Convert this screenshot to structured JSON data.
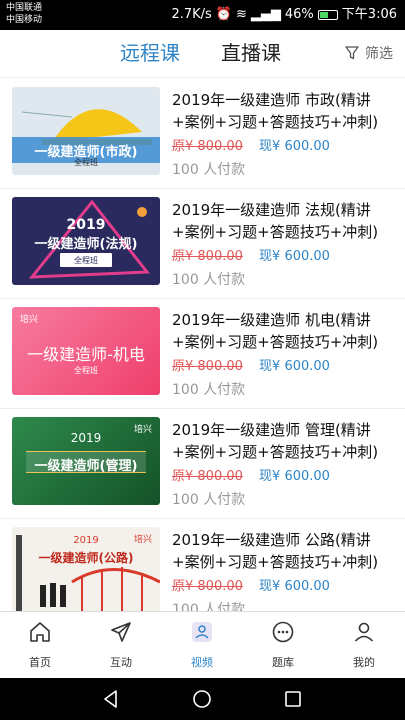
{
  "status_bar": {
    "carrier_1": "中国联通",
    "carrier_2": "中国移动",
    "speed": "2.7K/s",
    "battery": "46%",
    "time": "下午3:06"
  },
  "header": {
    "tab_remote": "远程课",
    "tab_live": "直播课",
    "filter_label": "筛选"
  },
  "courses": [
    {
      "title": "2019年一级建造师 市政(精讲+案例+习题+答题技巧+冲刺)",
      "original_price": "原¥ 800.00",
      "current_price": "现¥ 600.00",
      "buyers": "100 人付款",
      "thumb_caption": "一级建造师(市政)",
      "thumb_sub": "全程班",
      "thumb_color": "#f5c518"
    },
    {
      "title": "2019年一级建造师 法规(精讲+案例+习题+答题技巧+冲刺)",
      "original_price": "原¥ 800.00",
      "current_price": "现¥ 600.00",
      "buyers": "100 人付款",
      "thumb_year": "2019",
      "thumb_caption": "一级建造师(法规)",
      "thumb_sub": "全程班",
      "thumb_color": "#2a2a5e"
    },
    {
      "title": "2019年一级建造师 机电(精讲+案例+习题+答题技巧+冲刺)",
      "original_price": "原¥ 800.00",
      "current_price": "现¥ 600.00",
      "buyers": "100 人付款",
      "thumb_logo": "培兴",
      "thumb_caption": "一级建造师-机电",
      "thumb_sub": "全程班",
      "thumb_color": "#f2507a"
    },
    {
      "title": "2019年一级建造师 管理(精讲+案例+习题+答题技巧+冲刺)",
      "original_price": "原¥ 800.00",
      "current_price": "现¥ 600.00",
      "buyers": "100 人付款",
      "thumb_year": "2019",
      "thumb_caption": "一级建造师(管理)",
      "thumb_logo": "培兴",
      "thumb_color": "#1f6b3a"
    },
    {
      "title": "2019年一级建造师 公路(精讲+案例+习题+答题技巧+冲刺)",
      "original_price": "原¥ 800.00",
      "current_price": "现¥ 600.00",
      "buyers": "100 人付款",
      "thumb_year": "2019",
      "thumb_caption": "一级建造师(公路)",
      "thumb_logo": "培兴",
      "thumb_color": "#d93a2b"
    }
  ],
  "bottom_nav": {
    "home": "首页",
    "interact": "互动",
    "video": "视频",
    "question_bank": "题库",
    "mine": "我的"
  },
  "colors": {
    "accent": "#2d84c6",
    "strike_price": "#e05555"
  }
}
